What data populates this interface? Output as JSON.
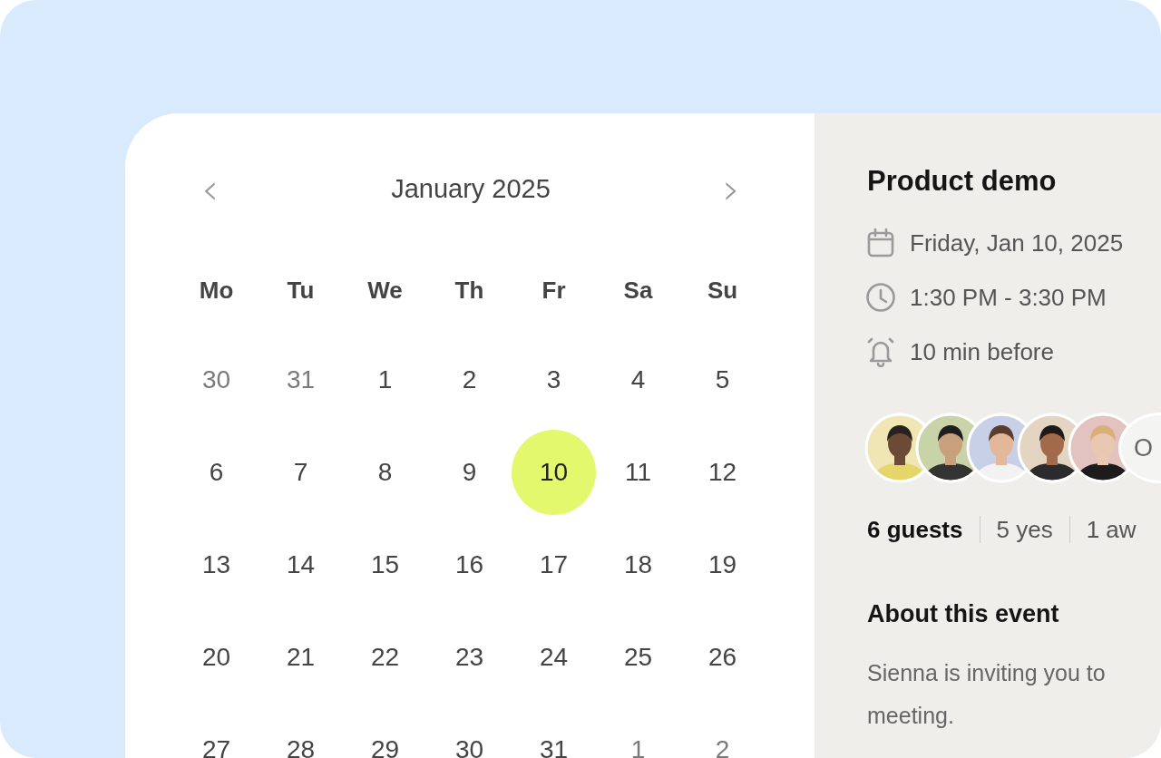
{
  "calendar": {
    "month_label": "January 2025",
    "prev": "‹",
    "next": "›",
    "weekdays": [
      "Mo",
      "Tu",
      "We",
      "Th",
      "Fr",
      "Sa",
      "Su"
    ],
    "weeks": [
      {
        "days": [
          {
            "label": "30",
            "in_month": false,
            "selected": false
          },
          {
            "label": "31",
            "in_month": false,
            "selected": false
          },
          {
            "label": "1",
            "in_month": true,
            "selected": false
          },
          {
            "label": "2",
            "in_month": true,
            "selected": false
          },
          {
            "label": "3",
            "in_month": true,
            "selected": false
          },
          {
            "label": "4",
            "in_month": true,
            "selected": false
          },
          {
            "label": "5",
            "in_month": true,
            "selected": false
          }
        ]
      },
      {
        "days": [
          {
            "label": "6",
            "in_month": true,
            "selected": false
          },
          {
            "label": "7",
            "in_month": true,
            "selected": false
          },
          {
            "label": "8",
            "in_month": true,
            "selected": false
          },
          {
            "label": "9",
            "in_month": true,
            "selected": false
          },
          {
            "label": "10",
            "in_month": true,
            "selected": true
          },
          {
            "label": "11",
            "in_month": true,
            "selected": false
          },
          {
            "label": "12",
            "in_month": true,
            "selected": false
          }
        ]
      },
      {
        "days": [
          {
            "label": "13",
            "in_month": true,
            "selected": false
          },
          {
            "label": "14",
            "in_month": true,
            "selected": false
          },
          {
            "label": "15",
            "in_month": true,
            "selected": false
          },
          {
            "label": "16",
            "in_month": true,
            "selected": false
          },
          {
            "label": "17",
            "in_month": true,
            "selected": false
          },
          {
            "label": "18",
            "in_month": true,
            "selected": false
          },
          {
            "label": "19",
            "in_month": true,
            "selected": false
          }
        ]
      },
      {
        "days": [
          {
            "label": "20",
            "in_month": true,
            "selected": false
          },
          {
            "label": "21",
            "in_month": true,
            "selected": false
          },
          {
            "label": "22",
            "in_month": true,
            "selected": false
          },
          {
            "label": "23",
            "in_month": true,
            "selected": false
          },
          {
            "label": "24",
            "in_month": true,
            "selected": false
          },
          {
            "label": "25",
            "in_month": true,
            "selected": false
          },
          {
            "label": "26",
            "in_month": true,
            "selected": false
          }
        ]
      },
      {
        "days": [
          {
            "label": "27",
            "in_month": true,
            "selected": false
          },
          {
            "label": "28",
            "in_month": true,
            "selected": false
          },
          {
            "label": "29",
            "in_month": true,
            "selected": false
          },
          {
            "label": "30",
            "in_month": true,
            "selected": false
          },
          {
            "label": "31",
            "in_month": true,
            "selected": false
          },
          {
            "label": "1",
            "in_month": false,
            "selected": false
          },
          {
            "label": "2",
            "in_month": false,
            "selected": false
          }
        ]
      }
    ]
  },
  "event": {
    "title": "Product demo",
    "details": [
      {
        "kind": "date",
        "text": "Friday, Jan 10, 2025"
      },
      {
        "kind": "time",
        "text": "1:30 PM - 3:30 PM"
      },
      {
        "kind": "reminder",
        "text": "10 min before"
      }
    ],
    "guests": [
      {
        "kind": "picture"
      },
      {
        "kind": "picture"
      },
      {
        "kind": "picture"
      },
      {
        "kind": "picture"
      },
      {
        "kind": "picture"
      },
      {
        "kind": "initials",
        "text": "O"
      }
    ],
    "guest_counts": [
      {
        "kind": "total",
        "text": "6 guests"
      },
      {
        "kind": "yes",
        "text": "5 yes"
      },
      {
        "kind": "awaiting",
        "text": "1 aw"
      }
    ],
    "about": {
      "heading": "About this event",
      "description": "Sienna is inviting you to meeting."
    }
  }
}
